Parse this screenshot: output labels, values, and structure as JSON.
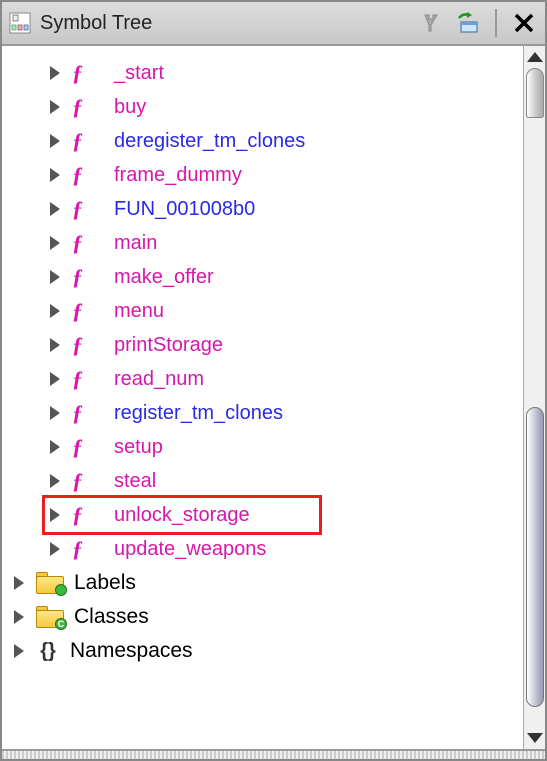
{
  "title": "Symbol Tree",
  "colors": {
    "magenta": "#d916ac",
    "blue": "#2a2ae6",
    "green": "#3cb83c",
    "highlight": "#ee1c1c"
  },
  "functions": [
    {
      "label": "_start",
      "color": "magenta"
    },
    {
      "label": "buy",
      "color": "magenta"
    },
    {
      "label": "deregister_tm_clones",
      "color": "blue"
    },
    {
      "label": "frame_dummy",
      "color": "magenta"
    },
    {
      "label": "FUN_001008b0",
      "color": "blue"
    },
    {
      "label": "main",
      "color": "magenta"
    },
    {
      "label": "make_offer",
      "color": "magenta"
    },
    {
      "label": "menu",
      "color": "magenta"
    },
    {
      "label": "printStorage",
      "color": "magenta"
    },
    {
      "label": "read_num",
      "color": "magenta"
    },
    {
      "label": "register_tm_clones",
      "color": "blue"
    },
    {
      "label": "setup",
      "color": "magenta"
    },
    {
      "label": "steal",
      "color": "magenta"
    },
    {
      "label": "unlock_storage",
      "color": "magenta",
      "highlighted": true
    },
    {
      "label": "update_weapons",
      "color": "magenta"
    }
  ],
  "rootItems": [
    {
      "label": "Labels",
      "icon": "folder",
      "dotColor": "#3cb83c"
    },
    {
      "label": "Classes",
      "icon": "folder",
      "dotColor": "#3cb83c",
      "dotLetter": "C"
    },
    {
      "label": "Namespaces",
      "icon": "ns"
    }
  ]
}
